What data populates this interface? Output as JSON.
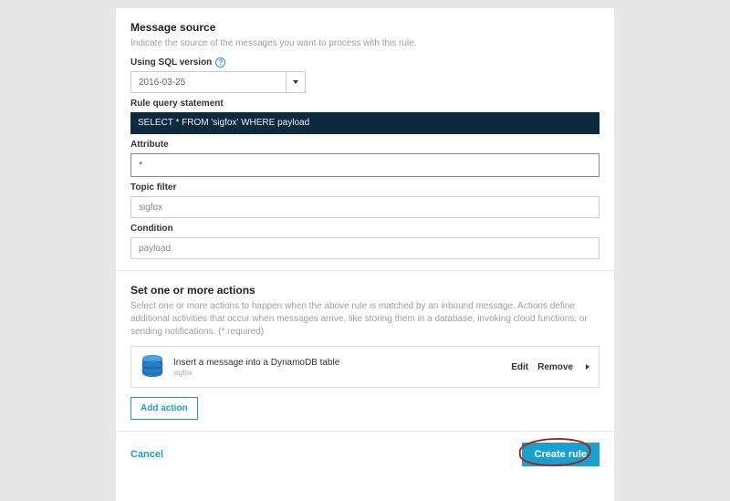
{
  "messageSource": {
    "title": "Message source",
    "desc": "Indicate the source of the messages you want to process with this rule.",
    "sqlLabel": "Using SQL version",
    "sqlValue": "2016-03-25",
    "queryLabel": "Rule query statement",
    "queryCode": "SELECT * FROM 'sigfox' WHERE payload",
    "attributeLabel": "Attribute",
    "attributeValue": "*",
    "topicLabel": "Topic filter",
    "topicValue": "sigfox",
    "conditionLabel": "Condition",
    "conditionValue": "payload"
  },
  "actions": {
    "title": "Set one or more actions",
    "desc": "Select one or more actions to happen when the above rule is matched by an inbound message. Actions define additional activities that occur when messages arrive, like storing them in a database, invoking cloud functions, or sending notifications. (*.required)",
    "item": {
      "title": "Insert a message into a DynamoDB table",
      "sub": "sigfox",
      "editLabel": "Edit",
      "removeLabel": "Remove"
    },
    "addLabel": "Add action"
  },
  "footer": {
    "cancel": "Cancel",
    "create": "Create rule"
  }
}
